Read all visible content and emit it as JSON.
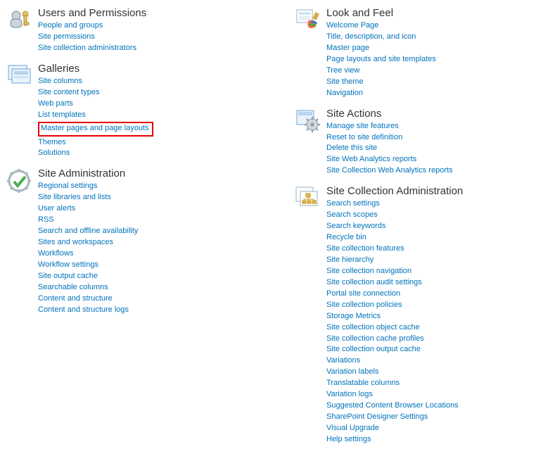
{
  "left": [
    {
      "title": "Users and Permissions",
      "icon": "users-key-icon",
      "links": [
        "People and groups",
        "Site permissions",
        "Site collection administrators"
      ]
    },
    {
      "title": "Galleries",
      "icon": "galleries-icon",
      "links": [
        "Site columns",
        "Site content types",
        "Web parts",
        "List templates",
        "Master pages and page layouts",
        "Themes",
        "Solutions"
      ],
      "highlightIndex": 4
    },
    {
      "title": "Site Administration",
      "icon": "site-admin-icon",
      "links": [
        "Regional settings",
        "Site libraries and lists",
        "User alerts",
        "RSS",
        "Search and offline availability",
        "Sites and workspaces",
        "Workflows",
        "Workflow settings",
        "Site output cache",
        "Searchable columns",
        "Content and structure",
        "Content and structure logs"
      ]
    }
  ],
  "right": [
    {
      "title": "Look and Feel",
      "icon": "look-feel-icon",
      "links": [
        "Welcome Page",
        "Title, description, and icon",
        "Master page",
        "Page layouts and site templates",
        "Tree view",
        "Site theme",
        "Navigation"
      ]
    },
    {
      "title": "Site Actions",
      "icon": "site-actions-icon",
      "links": [
        "Manage site features",
        "Reset to site definition",
        "Delete this site",
        "Site Web Analytics reports",
        "Site Collection Web Analytics reports"
      ]
    },
    {
      "title": "Site Collection Administration",
      "icon": "site-collection-admin-icon",
      "links": [
        "Search settings",
        "Search scopes",
        "Search keywords",
        "Recycle bin",
        "Site collection features",
        "Site hierarchy",
        "Site collection navigation",
        "Site collection audit settings",
        "Portal site connection",
        "Site collection policies",
        "Storage Metrics",
        "Site collection object cache",
        "Site collection cache profiles",
        "Site collection output cache",
        "Variations",
        "Variation labels",
        "Translatable columns",
        "Variation logs",
        "Suggested Content Browser Locations",
        "SharePoint Designer Settings",
        "Visual Upgrade",
        "Help settings"
      ]
    }
  ]
}
